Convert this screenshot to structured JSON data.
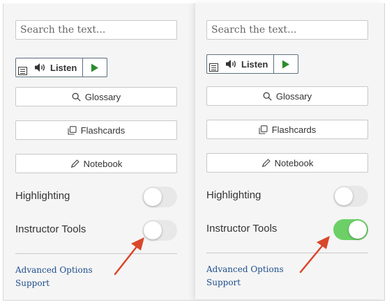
{
  "search": {
    "placeholder": "Search the text..."
  },
  "audio": {
    "listen_label": "Listen"
  },
  "tools": {
    "glossary_label": "Glossary",
    "flashcards_label": "Flashcards",
    "notebook_label": "Notebook"
  },
  "settings": {
    "highlighting_label": "Highlighting",
    "instructor_tools_label": "Instructor Tools",
    "left_panel": {
      "highlighting_on": false,
      "instructor_tools_on": false
    },
    "right_panel": {
      "highlighting_on": false,
      "instructor_tools_on": true
    }
  },
  "links": {
    "advanced_options": "Advanced Options",
    "support": "Support"
  },
  "colors": {
    "toggle_on": "#6cd067",
    "toggle_off": "#e8e8e8",
    "arrow": "#d9472b",
    "link": "#1f4e8c",
    "play": "#2e8b2e"
  }
}
